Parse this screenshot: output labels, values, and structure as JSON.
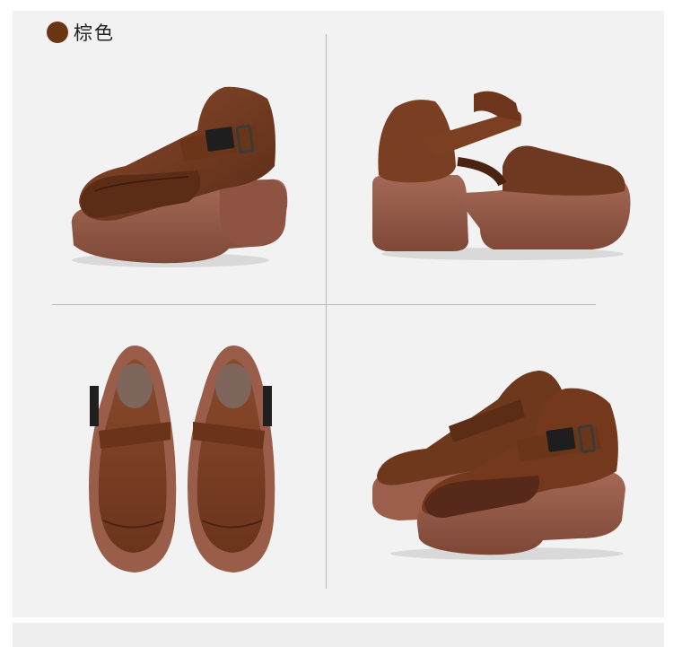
{
  "color_option": {
    "label": "棕色",
    "swatch_color": "#6b3413"
  },
  "photos": [
    {
      "view": "three-quarter-front-left"
    },
    {
      "view": "side-heel-right"
    },
    {
      "view": "top-pair"
    },
    {
      "view": "pair-three-quarter-right"
    }
  ],
  "colors": {
    "leather": "#7a4128",
    "leather_dark": "#4e2614",
    "sole": "#9a5e4c",
    "sole_dark": "#7b4536",
    "background": "#f2f2f2"
  }
}
